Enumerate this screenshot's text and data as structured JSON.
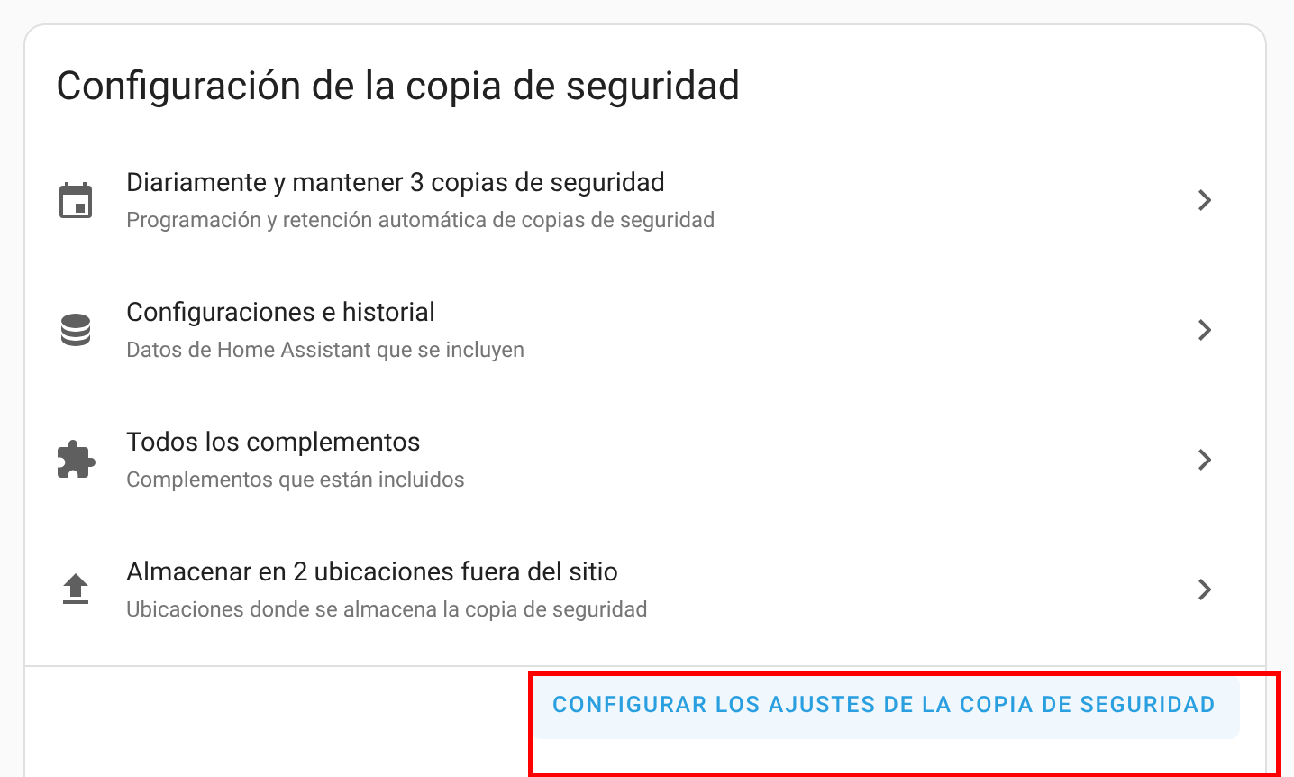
{
  "card": {
    "title": "Configuración de la copia de seguridad",
    "items": [
      {
        "kind": "calendar",
        "title": "Diariamente y mantener 3 copias de seguridad",
        "subtitle": "Programación y retención automática de copias de seguridad"
      },
      {
        "kind": "database",
        "title": "Configuraciones e historial",
        "subtitle": "Datos de Home Assistant que se incluyen"
      },
      {
        "kind": "puzzle",
        "title": "Todos los complementos",
        "subtitle": "Complementos que están incluidos"
      },
      {
        "kind": "upload",
        "title": "Almacenar en 2 ubicaciones fuera del sitio",
        "subtitle": "Ubicaciones donde se almacena la copia de seguridad"
      }
    ],
    "action": {
      "label": "CONFIGURAR LOS AJUSTES DE LA COPIA DE SEGURIDAD",
      "highlighted": true
    }
  }
}
